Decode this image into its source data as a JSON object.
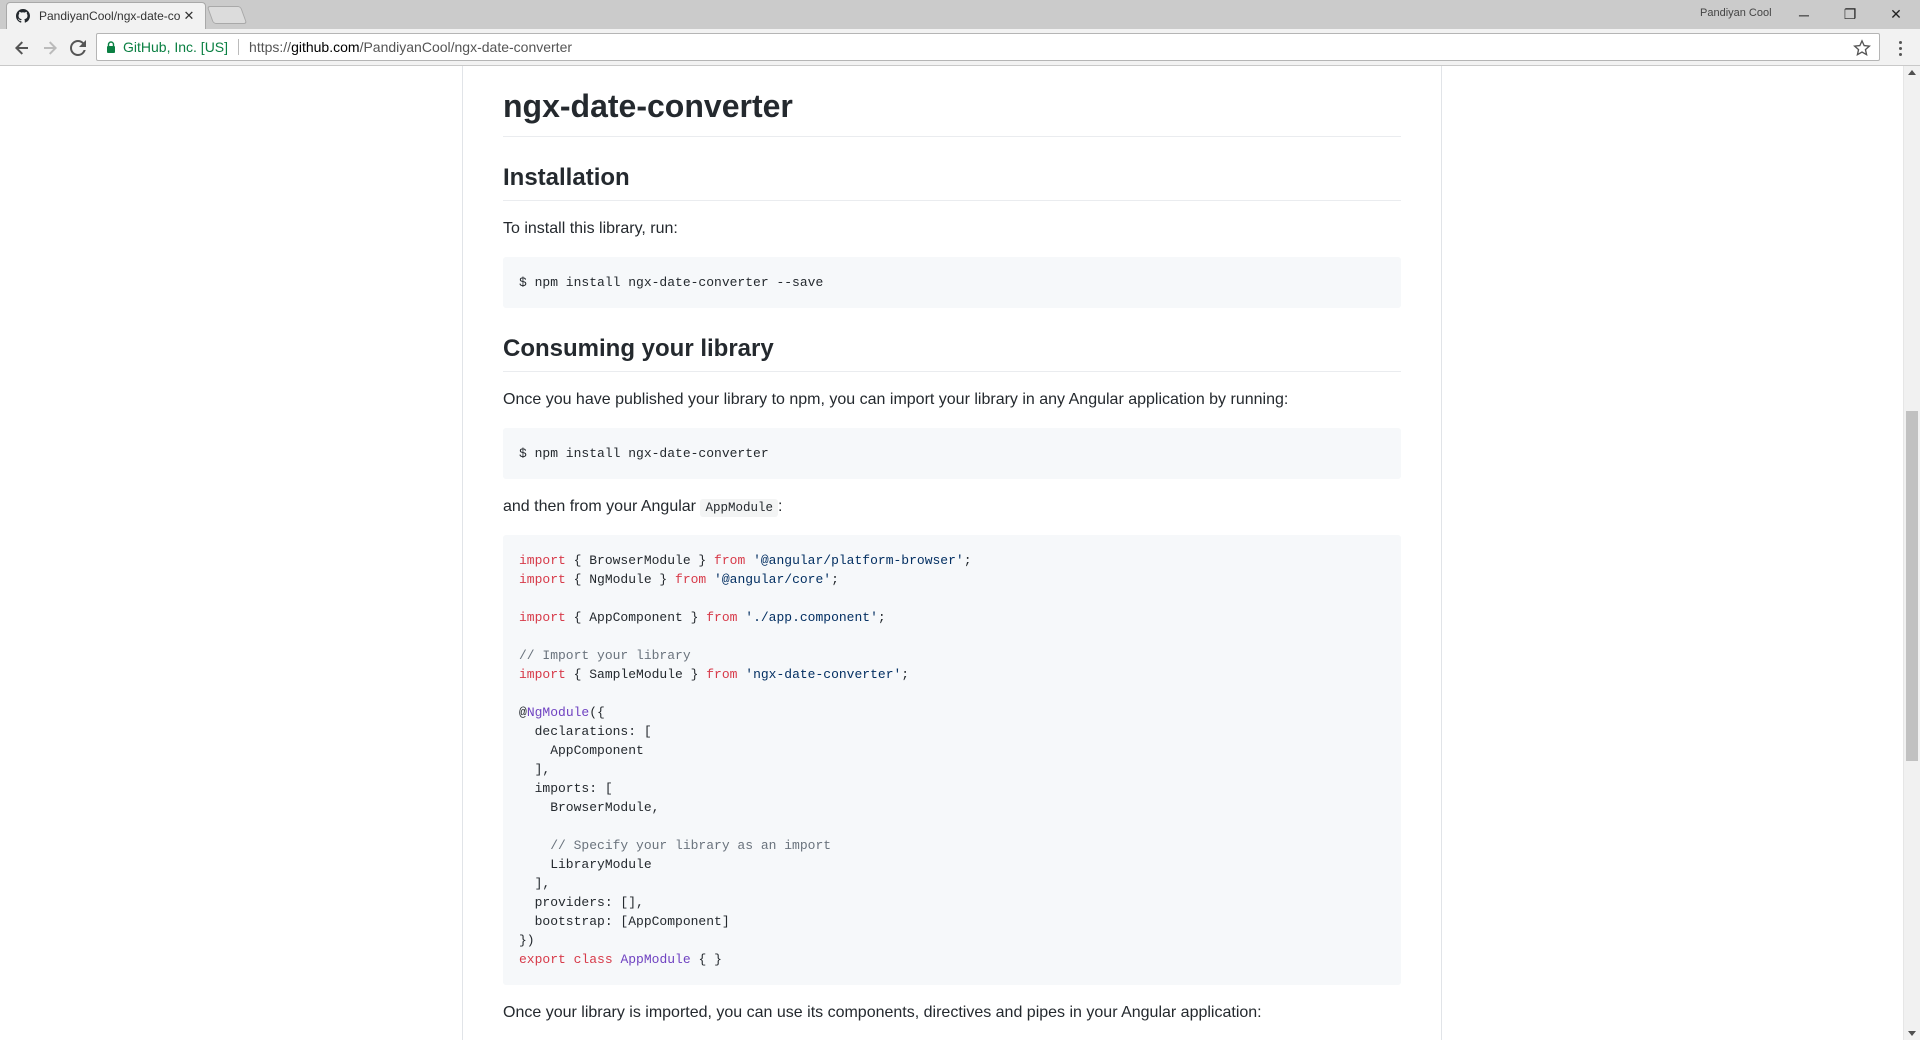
{
  "browser": {
    "tab_title": "PandiyanCool/ngx-date-converter",
    "profile_name": "Pandiyan Cool",
    "security_label": "GitHub, Inc. [US]",
    "url_prefix": "https://",
    "url_host": "github.com",
    "url_path": "/PandiyanCool/ngx-date-converter",
    "win_min": "─",
    "win_restore": "❐",
    "win_close": "✕",
    "tab_close": "✕"
  },
  "readme": {
    "title": "ngx-date-converter",
    "installation_heading": "Installation",
    "installation_text": "To install this library, run:",
    "install_cmd": "$ npm install ngx-date-converter --save",
    "consuming_heading": "Consuming your library",
    "consuming_text": "Once you have published your library to npm, you can import your library in any Angular application by running:",
    "consume_cmd": "$ npm install ngx-date-converter",
    "then_text": "and then from your Angular",
    "appmodule_inline": "AppModule",
    "then_suffix": ":",
    "code": {
      "l1_kw": "import",
      "l1_mid": " { BrowserModule } ",
      "l1_from": "from",
      "l1_str": " '@angular/platform-browser'",
      "l1_end": ";",
      "l2_kw": "import",
      "l2_mid": " { NgModule } ",
      "l2_from": "from",
      "l2_str": " '@angular/core'",
      "l2_end": ";",
      "l3_kw": "import",
      "l3_mid": " { AppComponent } ",
      "l3_from": "from",
      "l3_str": " './app.component'",
      "l3_end": ";",
      "l4_cm": "// Import your library",
      "l5_kw": "import",
      "l5_mid": " { SampleModule } ",
      "l5_from": "from",
      "l5_str": " 'ngx-date-converter'",
      "l5_end": ";",
      "l6_at": "@",
      "l6_ent": "NgModule",
      "l6_end": "({",
      "l7": "  declarations: [",
      "l8": "    AppComponent",
      "l9": "  ],",
      "l10": "  imports: [",
      "l11": "    BrowserModule,",
      "l12_cm": "    // Specify your library as an import",
      "l13": "    LibraryModule",
      "l14": "  ],",
      "l15": "  providers: [],",
      "l16": "  bootstrap: [AppComponent]",
      "l17": "})",
      "l18_kw": "export",
      "l18_sp": " ",
      "l18_kw2": "class",
      "l18_sp2": " ",
      "l18_ent": "AppModule",
      "l18_end": " { }"
    },
    "imported_text": "Once your library is imported, you can use its components, directives and pipes in your Angular application:"
  }
}
